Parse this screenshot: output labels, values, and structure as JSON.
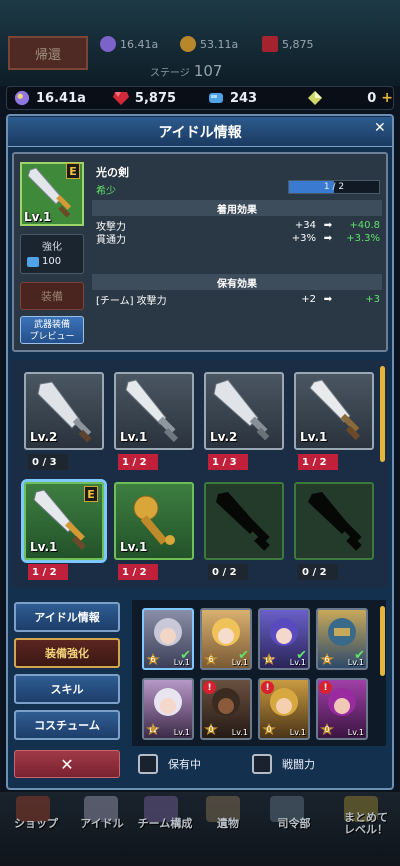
{
  "top_bg": {
    "return_label": "帰還",
    "stat1": "16.41a",
    "stat2": "53.11a",
    "stat3": "5,875",
    "stage_label": "ステージ",
    "stage_num": "107"
  },
  "resources": {
    "crystal": "16.41a",
    "ruby": "5,875",
    "bluegem": "243",
    "green": "0"
  },
  "panel": {
    "title": "アイドル情報"
  },
  "item": {
    "name": "光の剣",
    "rarity": "希少",
    "grade": "E",
    "level": "Lv.1",
    "progress_text": "1 / 2",
    "progress": 0.5,
    "enhance_label": "強化",
    "enhance_cost": "100",
    "equip_label": "装備",
    "preview_label_1": "武器装備",
    "preview_label_2": "プレビュー",
    "equip_effect_header": "着用効果",
    "equip_effects": [
      {
        "name": "攻撃力",
        "cur": "+34",
        "next": "+40.8"
      },
      {
        "name": "貫通力",
        "cur": "+3%",
        "next": "+3.3%"
      }
    ],
    "owned_effect_header": "保有効果",
    "owned_effects": [
      {
        "name": "[チーム] 攻撃力",
        "cur": "+2",
        "next": "+3"
      }
    ]
  },
  "weapons": [
    {
      "level": "Lv.2",
      "count": "0 / 3"
    },
    {
      "level": "Lv.1",
      "count": "1 / 2"
    },
    {
      "level": "Lv.2",
      "count": "1 / 3"
    },
    {
      "level": "Lv.1",
      "count": "1 / 2"
    },
    {
      "level": "Lv.1",
      "count": "1 / 2",
      "grade": "E"
    },
    {
      "level": "Lv.1",
      "count": "1 / 2"
    },
    {
      "level": "",
      "count": "0 / 2"
    },
    {
      "level": "",
      "count": "0 / 2"
    }
  ],
  "tabs": [
    "アイドル情報",
    "装備強化",
    "スキル",
    "コスチューム"
  ],
  "close_label": "✕",
  "characters": [
    {
      "level": "Lv.1",
      "stars": "6",
      "checked": true
    },
    {
      "level": "Lv.1",
      "stars": "6",
      "checked": true
    },
    {
      "level": "Lv.1",
      "stars": "10",
      "checked": true
    },
    {
      "level": "Lv.1",
      "stars": "6",
      "checked": true
    },
    {
      "level": "Lv.1",
      "stars": "12",
      "checked": false
    },
    {
      "level": "Lv.1",
      "stars": "0",
      "alert": true
    },
    {
      "level": "Lv.1",
      "stars": "0",
      "alert": true
    },
    {
      "level": "Lv.1",
      "stars": "0",
      "alert": true
    }
  ],
  "filters": {
    "owned": "保有中",
    "power": "戦闘力"
  },
  "nav": [
    "ショップ",
    "アイドル",
    "チーム構成",
    "遺物",
    "司令部",
    "まとめて",
    "レベル！"
  ],
  "colors": {
    "accent_gold": "#e3b53a",
    "count_red": "#c0203a",
    "effect_green": "#5fe36a"
  }
}
